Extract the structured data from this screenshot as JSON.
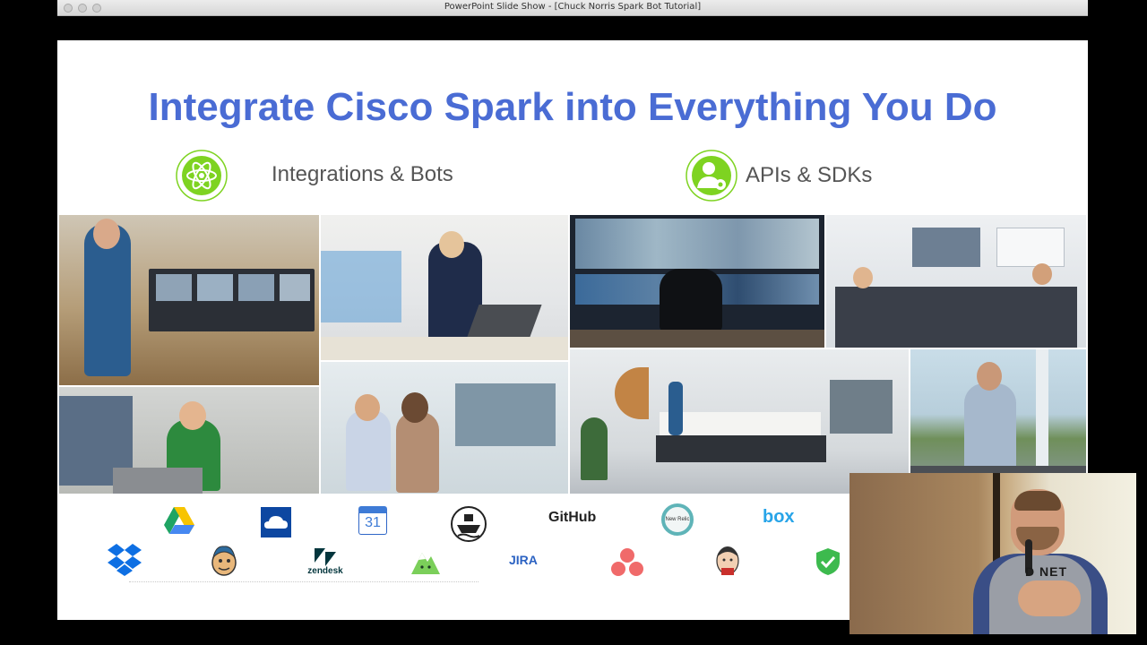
{
  "window": {
    "title": "PowerPoint Slide Show - [Chuck Norris Spark Bot Tutorial]"
  },
  "slide": {
    "title": "Integrate Cisco Spark into Everything You Do",
    "categories": [
      {
        "label": "Integrations & Bots",
        "icon": "atom-icon"
      },
      {
        "label": "APIs & SDKs",
        "icon": "user-key-icon"
      }
    ],
    "photos": [
      "woman-control-room-photo",
      "woman-laptop-photo",
      "control-room-wall-photo",
      "meeting-room-photo",
      "man-video-call-photo",
      "two-people-video-call-photo",
      "presentation-room-photo",
      "man-bridge-phone-photo"
    ],
    "logos_row1": [
      {
        "name": "google-drive-logo"
      },
      {
        "name": "onedrive-logo"
      },
      {
        "name": "google-calendar-logo",
        "text": "31"
      },
      {
        "name": "ship-logo"
      },
      {
        "name": "github-logo",
        "text": "GitHub"
      },
      {
        "name": "newrelic-logo",
        "text": "New Relic"
      },
      {
        "name": "box-logo",
        "text": "box"
      }
    ],
    "logos_row2": [
      {
        "name": "dropbox-logo"
      },
      {
        "name": "mailchimp-logo"
      },
      {
        "name": "zendesk-logo",
        "text": "zendesk"
      },
      {
        "name": "mountain-logo"
      },
      {
        "name": "jira-logo",
        "text": "JIRA"
      },
      {
        "name": "asana-logo"
      },
      {
        "name": "jenkins-logo"
      },
      {
        "name": "shield-check-logo"
      }
    ],
    "colors": {
      "title": "#4a6cd4",
      "icon_green": "#7ed321",
      "box_blue": "#27a4e8"
    }
  },
  "webcam": {
    "shirt_text": "D NET"
  }
}
